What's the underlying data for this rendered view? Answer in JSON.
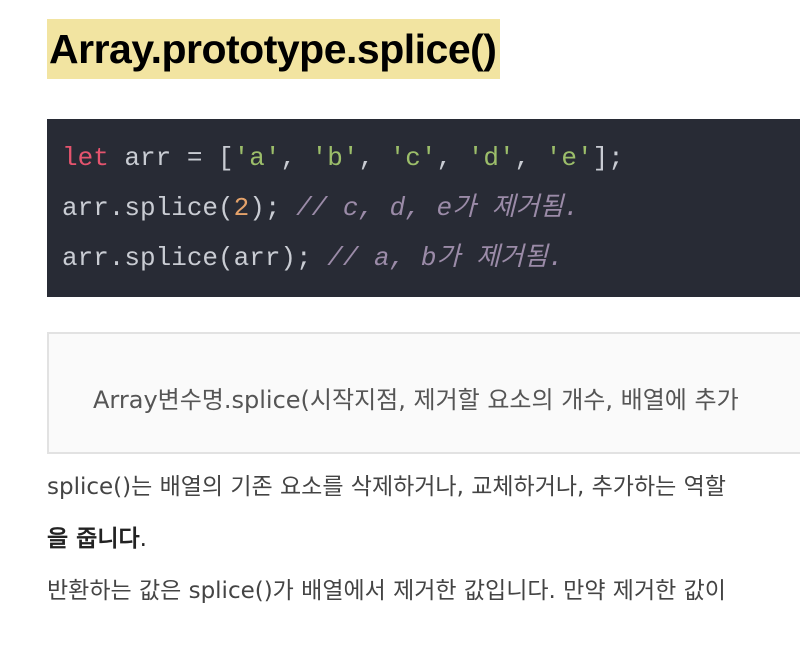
{
  "heading": "Array.prototype.splice()",
  "code": {
    "line1": {
      "kw": "let",
      "p1": " arr = [",
      "s1": "'a'",
      "c1": ", ",
      "s2": "'b'",
      "c2": ", ",
      "s3": "'c'",
      "c3": ", ",
      "s4": "'d'",
      "c4": ", ",
      "s5": "'e'",
      "p2": "];"
    },
    "line2": {
      "p1": "arr.splice(",
      "num": "2",
      "p2": "); ",
      "comment": "// c, d, e가 제거됨."
    },
    "line3": {
      "p1": "arr.splice(arr); ",
      "comment": "// a, b가 제거됨."
    }
  },
  "callout": "Array변수명.splice(시작지점, 제거할 요소의 개수, 배열에 추가",
  "paragraphs": {
    "p1": "splice()는 배열의 기존 요소를 삭제하거나, 교체하거나, 추가하는 역할",
    "p2_bold": "을 줍니다",
    "p2_end": ".",
    "p3": "반환하는 값은 splice()가 배열에서 제거한 값입니다. 만약 제거한 값이"
  }
}
